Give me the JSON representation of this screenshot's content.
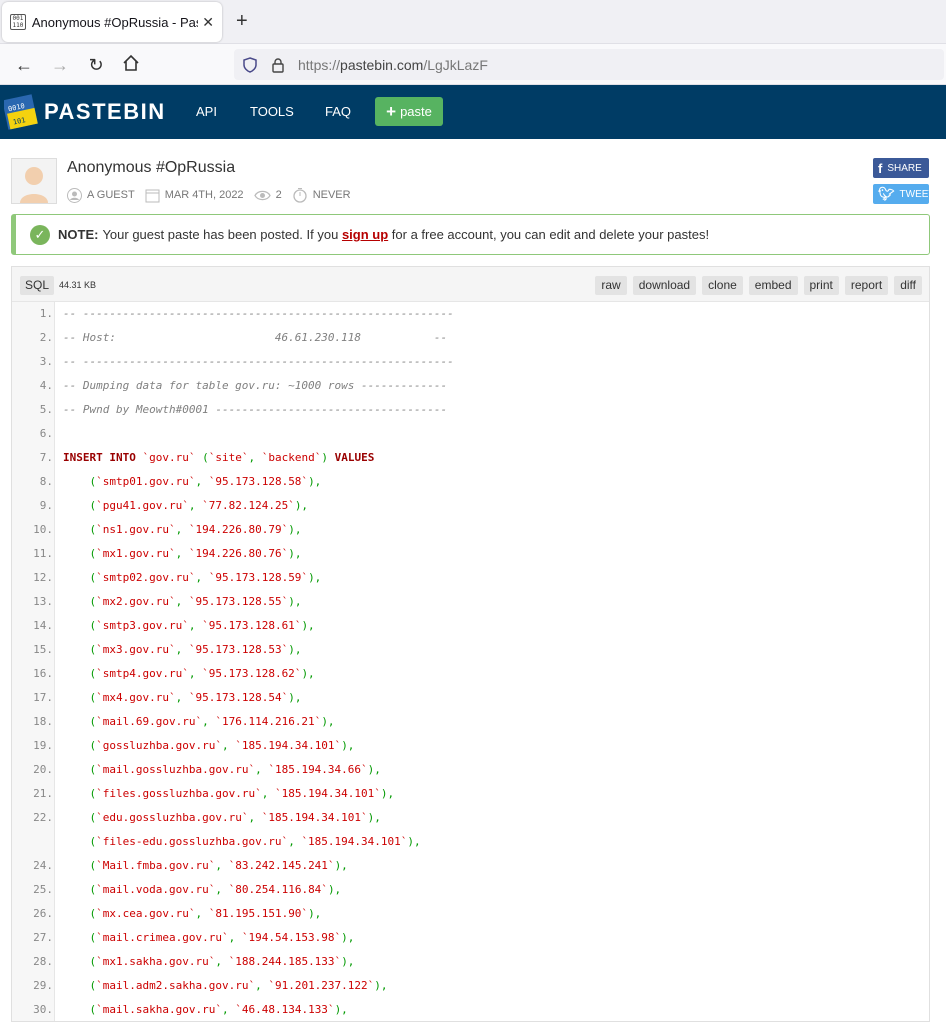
{
  "browser": {
    "tab_title": "Anonymous #OpRussia - Pastebin.com",
    "favicon_text": "001 110",
    "url_scheme": "https://",
    "url_host": "pastebin.com",
    "url_path": "/LgJkLazF"
  },
  "header": {
    "logo_text": "PASTEBIN",
    "nav": [
      "API",
      "TOOLS",
      "FAQ"
    ],
    "paste_button": "paste",
    "colors": {
      "bar": "#003c65",
      "paste": "#57b361"
    }
  },
  "paste": {
    "title": "Anonymous #OpRussia",
    "author": "A GUEST",
    "date": "MAR 4TH, 2022",
    "views": "2",
    "expiry": "NEVER",
    "share_label": "SHARE",
    "tweet_label": "TWEET"
  },
  "note": {
    "label": "NOTE:",
    "text_before": "Your guest paste has been posted. If you",
    "link": "sign up",
    "text_after": "for a free account, you can edit and delete your pastes!"
  },
  "code": {
    "language": "SQL",
    "size": "44.31 KB",
    "actions": [
      "raw",
      "download",
      "clone",
      "embed",
      "print",
      "report",
      "diff"
    ],
    "lines": [
      {
        "n": "1.",
        "kind": "comment",
        "text": "-- --------------------------------------------------------"
      },
      {
        "n": "2.",
        "kind": "comment",
        "text": "-- Host:                        46.61.230.118           --"
      },
      {
        "n": "3.",
        "kind": "comment",
        "text": "-- --------------------------------------------------------"
      },
      {
        "n": "4.",
        "kind": "comment",
        "text": "-- Dumping data for table gov.ru: ~1000 rows -------------"
      },
      {
        "n": "5.",
        "kind": "comment",
        "text": "-- Pwnd by Meowth#0001 -----------------------------------"
      },
      {
        "n": "6.",
        "kind": "blank",
        "text": ""
      },
      {
        "n": "7.",
        "kind": "insert",
        "text": "INSERT INTO `gov.ru` (`site`, `backend`) VALUES"
      },
      {
        "n": "8.",
        "kind": "row",
        "site": "smtp01.gov.ru",
        "ip": "95.173.128.58"
      },
      {
        "n": "9.",
        "kind": "row",
        "site": "pgu41.gov.ru",
        "ip": "77.82.124.25"
      },
      {
        "n": "10.",
        "kind": "row",
        "site": "ns1.gov.ru",
        "ip": "194.226.80.79"
      },
      {
        "n": "11.",
        "kind": "row",
        "site": "mx1.gov.ru",
        "ip": "194.226.80.76"
      },
      {
        "n": "12.",
        "kind": "row",
        "site": "smtp02.gov.ru",
        "ip": "95.173.128.59"
      },
      {
        "n": "13.",
        "kind": "row",
        "site": "mx2.gov.ru",
        "ip": "95.173.128.55"
      },
      {
        "n": "14.",
        "kind": "row",
        "site": "smtp3.gov.ru",
        "ip": "95.173.128.61"
      },
      {
        "n": "15.",
        "kind": "row",
        "site": "mx3.gov.ru",
        "ip": "95.173.128.53"
      },
      {
        "n": "16.",
        "kind": "row",
        "site": "smtp4.gov.ru",
        "ip": "95.173.128.62"
      },
      {
        "n": "17.",
        "kind": "row",
        "site": "mx4.gov.ru",
        "ip": "95.173.128.54"
      },
      {
        "n": "18.",
        "kind": "row",
        "site": "mail.69.gov.ru",
        "ip": "176.114.216.21"
      },
      {
        "n": "19.",
        "kind": "row",
        "site": "gossluzhba.gov.ru",
        "ip": "185.194.34.101"
      },
      {
        "n": "20.",
        "kind": "row",
        "site": "mail.gossluzhba.gov.ru",
        "ip": "185.194.34.66"
      },
      {
        "n": "21.",
        "kind": "row",
        "site": "files.gossluzhba.gov.ru",
        "ip": "185.194.34.101"
      },
      {
        "n": "22.",
        "kind": "row",
        "site": "edu.gossluzhba.gov.ru",
        "ip": "185.194.34.101"
      },
      {
        "n": "",
        "kind": "row",
        "site": "files-edu.gossluzhba.gov.ru",
        "ip": "185.194.34.101"
      },
      {
        "n": "24.",
        "kind": "row",
        "site": "Mail.fmba.gov.ru",
        "ip": "83.242.145.241"
      },
      {
        "n": "25.",
        "kind": "row",
        "site": "mail.voda.gov.ru",
        "ip": "80.254.116.84"
      },
      {
        "n": "26.",
        "kind": "row",
        "site": "mx.cea.gov.ru",
        "ip": "81.195.151.90"
      },
      {
        "n": "27.",
        "kind": "row",
        "site": "mail.crimea.gov.ru",
        "ip": "194.54.153.98"
      },
      {
        "n": "28.",
        "kind": "row",
        "site": "mx1.sakha.gov.ru",
        "ip": "188.244.185.133"
      },
      {
        "n": "29.",
        "kind": "row",
        "site": "mail.adm2.sakha.gov.ru",
        "ip": "91.201.237.122"
      },
      {
        "n": "30.",
        "kind": "row",
        "site": "mail.sakha.gov.ru",
        "ip": "46.48.134.133"
      }
    ]
  }
}
